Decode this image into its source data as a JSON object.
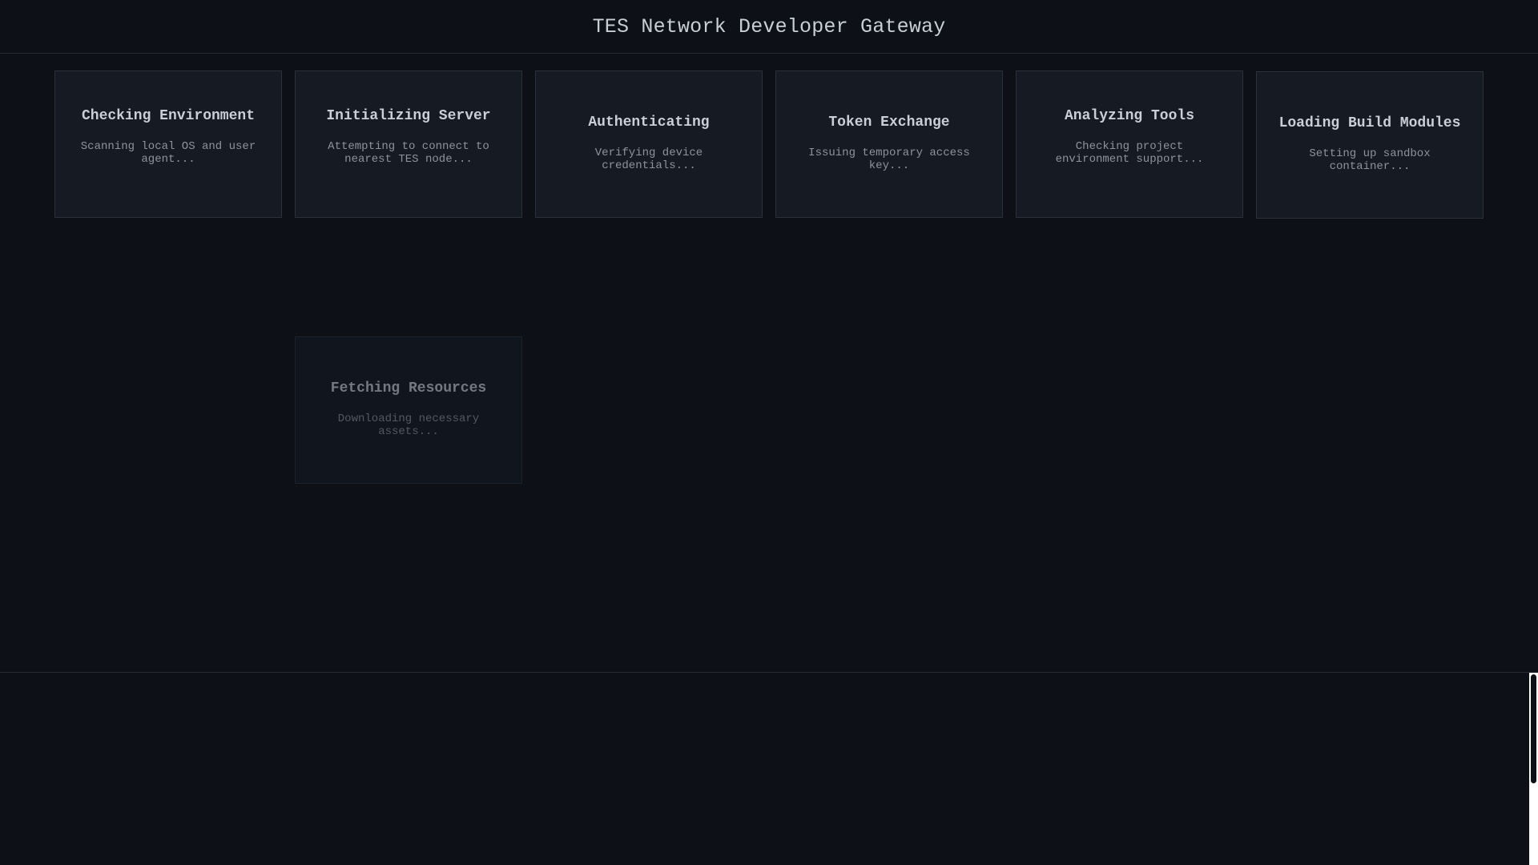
{
  "header": {
    "title": "TES Network Developer Gateway"
  },
  "cards": [
    {
      "title": "Checking Environment",
      "description": "Scanning local OS and user agent..."
    },
    {
      "title": "Initializing Server",
      "description": "Attempting to connect to nearest TES node..."
    },
    {
      "title": "Authenticating",
      "description": "Verifying device credentials..."
    },
    {
      "title": "Token Exchange",
      "description": "Issuing temporary access key..."
    },
    {
      "title": "Analyzing Tools",
      "description": "Checking project environment support..."
    },
    {
      "title": "Loading Build Modules",
      "description": "Setting up sandbox container..."
    },
    {
      "title": "Fetching Resources",
      "description": "Downloading necessary assets..."
    }
  ],
  "colors": {
    "background": "#0d1017",
    "card_background": "#161a22",
    "card_border": "#2b3039",
    "title_text": "#c9cfd8",
    "description_text": "#8d939c"
  }
}
